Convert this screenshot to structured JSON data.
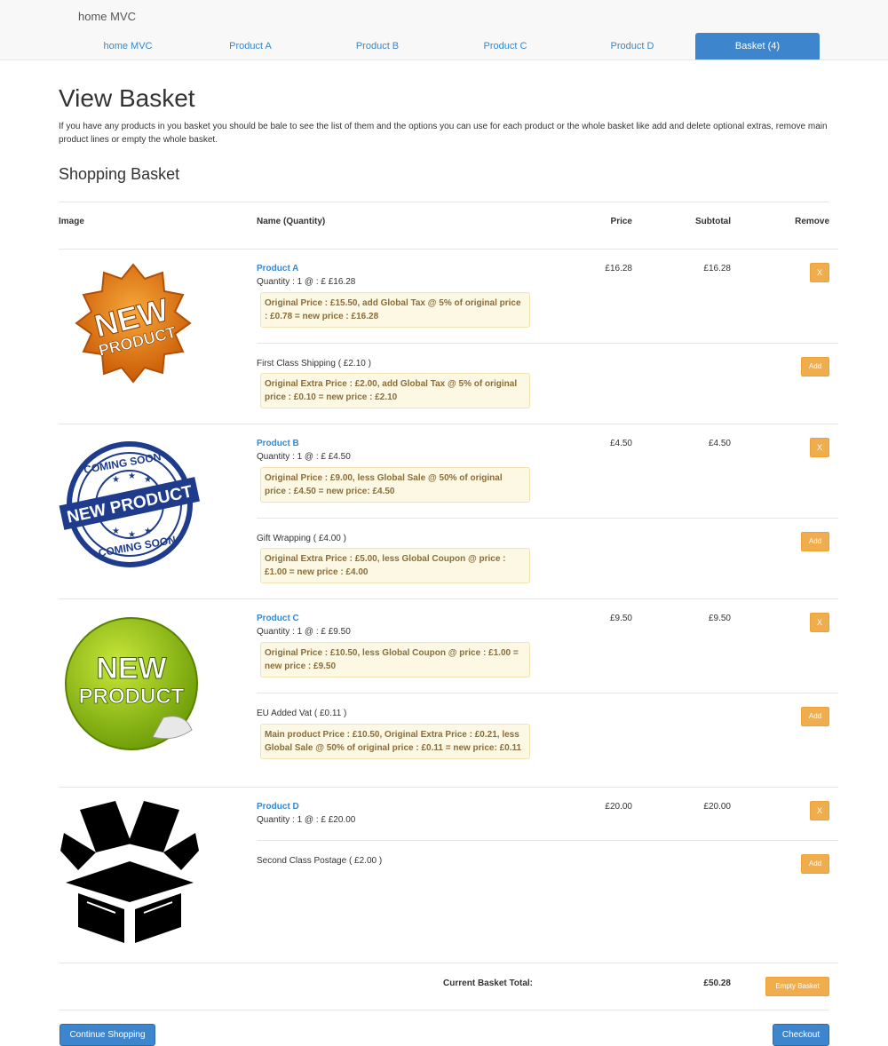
{
  "navbar": {
    "brand": "home MVC",
    "items": [
      "home MVC",
      "Product A",
      "Product B",
      "Product C",
      "Product D",
      "Basket (4)"
    ]
  },
  "page": {
    "title": "View Basket",
    "intro": "If you have any products in you basket you should be bale to see the list of them and the options you can use for each product or the whole basket like add and delete optional extras, remove main product lines or empty the whole basket.",
    "subtitle": "Shopping Basket"
  },
  "table": {
    "headers": {
      "image": "Image",
      "name": "Name (Quantity)",
      "price": "Price",
      "subtotal": "Subtotal",
      "remove": "Remove"
    },
    "remove_label": "X",
    "add_label": "Add",
    "products": [
      {
        "name": "Product A",
        "quantity": "Quantity : 1 @ : £ £16.28",
        "note": "Original Price : £15.50, add Global Tax @ 5% of original price : £0.78 = new price : £16.28",
        "price": "£16.28",
        "subtotal": "£16.28",
        "image_text": "NEW PRODUCT",
        "extra": "First Class Shipping ( £2.10 )",
        "extra_note": "Original Extra Price : £2.00, add Global Tax @ 5% of original price : £0.10 = new price : £2.10"
      },
      {
        "name": "Product B",
        "quantity": "Quantity : 1 @ : £ £4.50",
        "note": "Original Price : £9.00, less Global Sale @ 50% of original price : £4.50 = new price: £4.50",
        "price": "£4.50",
        "subtotal": "£4.50",
        "image_text_top": "COMING SOON",
        "image_text": "NEW PRODUCT",
        "image_text_bottom": "COMING SOON",
        "extra": "Gift Wrapping ( £4.00 )",
        "extra_note": "Original Extra Price : £5.00, less Global Coupon @ price : £1.00 = new price : £4.00"
      },
      {
        "name": "Product C",
        "quantity": "Quantity : 1 @ : £ £9.50",
        "note": "Original Price : £10.50, less Global Coupon @ price : £1.00 = new price : £9.50",
        "price": "£9.50",
        "subtotal": "£9.50",
        "image_text_1": "NEW",
        "image_text_2": "PRODUCT",
        "extra": "EU Added Vat ( £0.11 )",
        "extra_note": "Main product Price : £10.50, Original Extra Price : £0.21, less Global Sale @ 50% of original price : £0.11 = new price: £0.11"
      },
      {
        "name": "Product D",
        "quantity": "Quantity : 1 @ : £ £20.00",
        "price": "£20.00",
        "subtotal": "£20.00",
        "extra": "Second Class Postage ( £2.00 )"
      }
    ]
  },
  "footer": {
    "total_label": "Current Basket Total:",
    "total_value": "£50.28",
    "empty_label": "Empty Basket",
    "continue_label": "Continue Shopping",
    "checkout_label": "Checkout"
  },
  "colors": {
    "primary": "#3d86ce",
    "warning": "#f0ad4e",
    "note_bg": "#fcf8e3",
    "note_text": "#8a6d3b",
    "link": "#3a87c9"
  }
}
